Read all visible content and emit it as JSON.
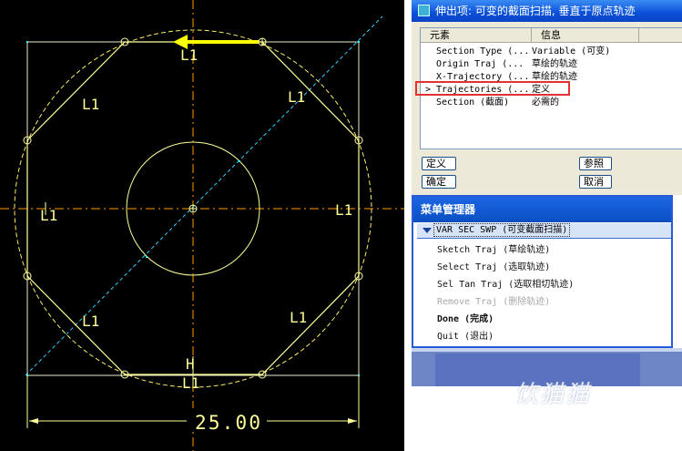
{
  "sketch": {
    "dimension_text": "25.00",
    "constraint_labels": [
      "L1",
      "L1",
      "L1",
      "L1",
      "L1",
      "L1",
      "L1",
      "L1",
      "H",
      "H"
    ],
    "arrow_color": "#ffff00",
    "line_color": "#ffff99",
    "construction_color": "#ffcc33",
    "axis_color": "#ff9900",
    "point_color": "#33ffff"
  },
  "dialog": {
    "title": "伸出项: 可变的截面扫描, 垂直于原点轨迹",
    "columns": [
      "元素",
      "信息"
    ],
    "rows": [
      {
        "element": "Section Type (...",
        "info": "Variable (可变)",
        "current": false
      },
      {
        "element": "Origin Traj (...",
        "info": "草绘的轨迹",
        "current": false
      },
      {
        "element": "X-Trajectory (...",
        "info": "草绘的轨迹",
        "current": false
      },
      {
        "element": "Trajectories (...",
        "info": "定义",
        "current": true
      },
      {
        "element": "Section (截面)",
        "info": "必需的",
        "current": false
      }
    ],
    "current_marker": ">",
    "buttons": {
      "define": "定义",
      "refs": "参照",
      "ok": "确定",
      "cancel": "取消"
    },
    "highlight_color": "#e33030"
  },
  "menu_manager": {
    "title": "菜单管理器",
    "submenu": "VAR SEC SWP (可变截面扫描)",
    "items": [
      {
        "label": "Sketch Traj (草绘轨迹)",
        "enabled": true,
        "bold": false
      },
      {
        "label": "Select Traj (选取轨迹)",
        "enabled": true,
        "bold": false
      },
      {
        "label": "Sel Tan Traj (选取相切轨迹)",
        "enabled": true,
        "bold": false
      },
      {
        "label": "Remove Traj (删除轨迹)",
        "enabled": false,
        "bold": false
      },
      {
        "label": "Done (完成)",
        "enabled": true,
        "bold": true
      },
      {
        "label": "Quit (退出)",
        "enabled": true,
        "bold": false
      }
    ]
  },
  "watermark": "饮猫猫"
}
